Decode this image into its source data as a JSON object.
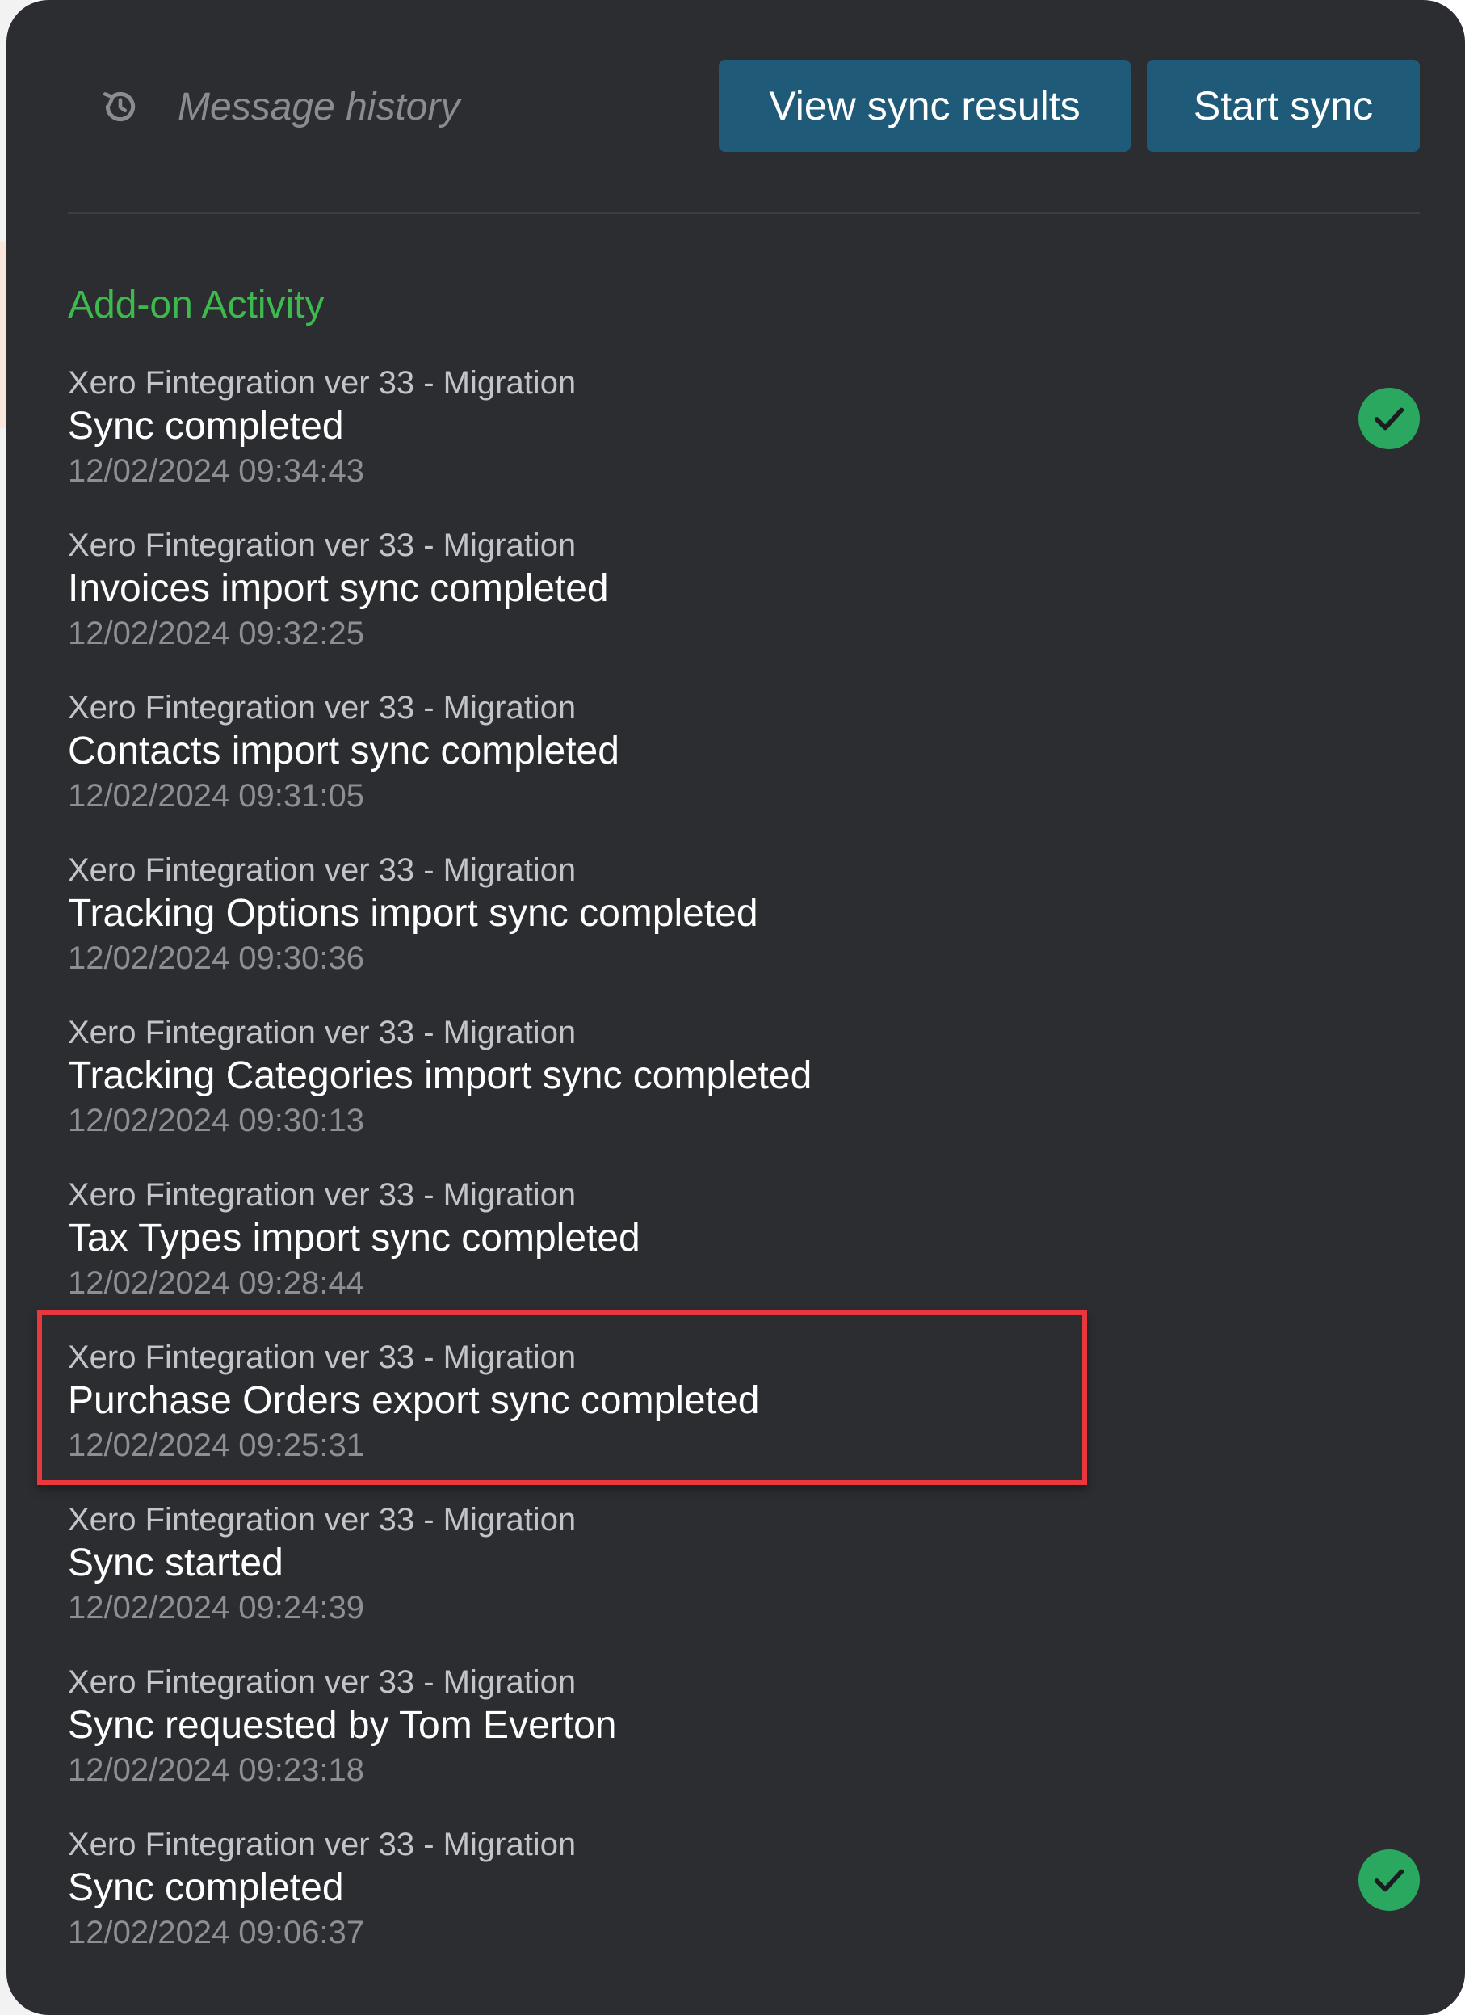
{
  "header": {
    "history_label": "Message history",
    "history_icon": "history-icon",
    "view_results_label": "View sync results",
    "start_sync_label": "Start sync",
    "button_color": "#1f5b79"
  },
  "section": {
    "title": "Add-on Activity",
    "title_color": "#3dba4e"
  },
  "activity": [
    {
      "source": "Xero Fintegration ver 33 - Migration",
      "message": "Sync completed",
      "time": "12/02/2024 09:34:43",
      "status_icon": "check-circle-icon"
    },
    {
      "source": "Xero Fintegration ver 33 - Migration",
      "message": "Invoices import sync completed",
      "time": "12/02/2024 09:32:25"
    },
    {
      "source": "Xero Fintegration ver 33 - Migration",
      "message": "Contacts import sync completed",
      "time": "12/02/2024 09:31:05"
    },
    {
      "source": "Xero Fintegration ver 33 - Migration",
      "message": "Tracking Options import sync completed",
      "time": "12/02/2024 09:30:36"
    },
    {
      "source": "Xero Fintegration ver 33 - Migration",
      "message": "Tracking Categories import sync completed",
      "time": "12/02/2024 09:30:13"
    },
    {
      "source": "Xero Fintegration ver 33 - Migration",
      "message": "Tax Types import sync completed",
      "time": "12/02/2024 09:28:44"
    },
    {
      "source": "Xero Fintegration ver 33 - Migration",
      "message": "Purchase Orders export sync completed",
      "time": "12/02/2024 09:25:31",
      "highlighted": true
    },
    {
      "source": "Xero Fintegration ver 33 - Migration",
      "message": "Sync started",
      "time": "12/02/2024 09:24:39"
    },
    {
      "source": "Xero Fintegration ver 33 - Migration",
      "message": "Sync requested by Tom Everton",
      "time": "12/02/2024 09:23:18"
    },
    {
      "source": "Xero Fintegration ver 33 - Migration",
      "message": "Sync completed",
      "time": "12/02/2024 09:06:37",
      "status_icon": "check-circle-icon"
    }
  ],
  "colors": {
    "panel_background": "#2c2d31",
    "success": "#2aa860",
    "highlight_border": "#e8383d"
  }
}
